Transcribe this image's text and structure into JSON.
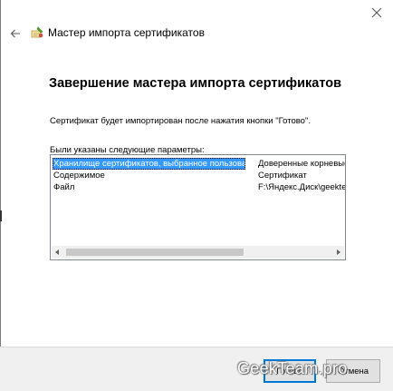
{
  "window": {
    "title": "Мастер импорта сертификатов"
  },
  "page": {
    "heading": "Завершение мастера импорта сертификатов",
    "description": "Сертификат будет импортирован после нажатия кнопки \"Готово\".",
    "params_label": "Были указаны следующие параметры:"
  },
  "params": [
    {
      "name": "Хранилище сертификатов, выбранное пользователем",
      "value": "Доверенные корневые центры"
    },
    {
      "name": "Содержимое",
      "value": "Сертификат"
    },
    {
      "name": "Файл",
      "value": "F:\\Яндекс.Диск\\geekteam.pro"
    }
  ],
  "buttons": {
    "finish": "Готово",
    "cancel": "Отмена"
  },
  "watermark": "GeekTeam.pro",
  "colors": {
    "selection": "#3399ff",
    "default_button_border": "#0078d7",
    "footer_bg": "#f0f0f0"
  },
  "icons": {
    "back": "back-arrow-icon",
    "close": "close-icon",
    "wizard": "certificate-wizard-icon"
  }
}
